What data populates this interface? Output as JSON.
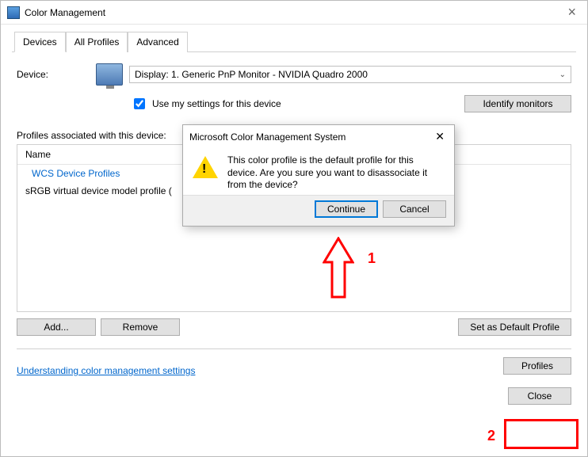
{
  "window": {
    "title": "Color Management",
    "close_glyph": "×"
  },
  "tabs": {
    "devices": "Devices",
    "all_profiles": "All Profiles",
    "advanced": "Advanced"
  },
  "device": {
    "label": "Device:",
    "selected": "Display: 1. Generic PnP Monitor - NVIDIA Quadro 2000",
    "use_my_settings": "Use my settings for this device",
    "checked": true,
    "identify_btn": "Identify monitors"
  },
  "profiles": {
    "section_label": "Profiles associated with this device:",
    "col_name": "Name",
    "group": "WCS Device Profiles",
    "item": "sRGB virtual device model profile (",
    "add_btn": "Add...",
    "remove_btn": "Remove",
    "set_default_btn": "Set as Default Profile"
  },
  "footer": {
    "link": "Understanding color management settings",
    "profiles_btn": "Profiles",
    "close_btn": "Close"
  },
  "dialog": {
    "title": "Microsoft Color Management System",
    "message": "This color profile is the default profile for this device. Are you sure you want to disassociate it from the device?",
    "continue_btn": "Continue",
    "cancel_btn": "Cancel",
    "close_glyph": "✕"
  },
  "annotations": {
    "one": "1",
    "two": "2"
  }
}
